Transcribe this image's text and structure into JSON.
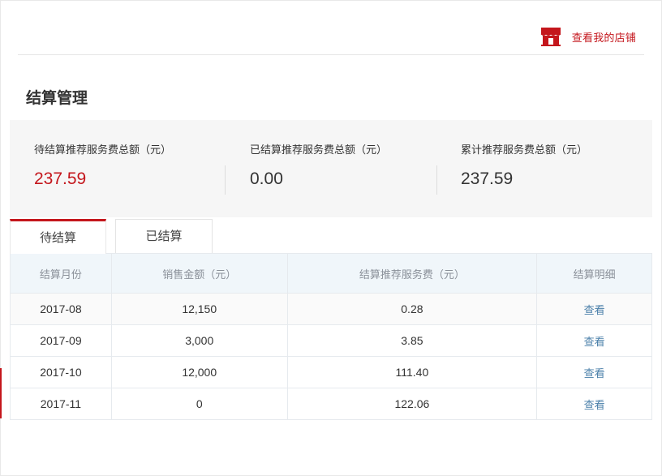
{
  "header": {
    "shop_link_label": "查看我的店铺",
    "shop_icon": "storefront-icon"
  },
  "page": {
    "title": "结算管理"
  },
  "summary": [
    {
      "label": "待结算推荐服务费总额（元）",
      "value": "237.59",
      "highlight": true
    },
    {
      "label": "已结算推荐服务费总额（元）",
      "value": "0.00",
      "highlight": false
    },
    {
      "label": "累计推荐服务费总额（元）",
      "value": "237.59",
      "highlight": false
    }
  ],
  "tabs": [
    {
      "label": "待结算",
      "active": true
    },
    {
      "label": "已结算",
      "active": false
    }
  ],
  "table": {
    "headers": [
      "结算月份",
      "销售金额（元）",
      "结算推荐服务费（元）",
      "结算明细"
    ],
    "rows": [
      {
        "month": "2017-08",
        "sales": "12,150",
        "fee": "0.28",
        "action": "查看"
      },
      {
        "month": "2017-09",
        "sales": "3,000",
        "fee": "3.85",
        "action": "查看"
      },
      {
        "month": "2017-10",
        "sales": "12,000",
        "fee": "111.40",
        "action": "查看"
      },
      {
        "month": "2017-11",
        "sales": "0",
        "fee": "122.06",
        "action": "查看"
      }
    ]
  },
  "colors": {
    "accent": "#c4161c",
    "link": "#4a7fa9",
    "table_header_bg": "#f0f6fa",
    "summary_bg": "#f6f6f6"
  }
}
